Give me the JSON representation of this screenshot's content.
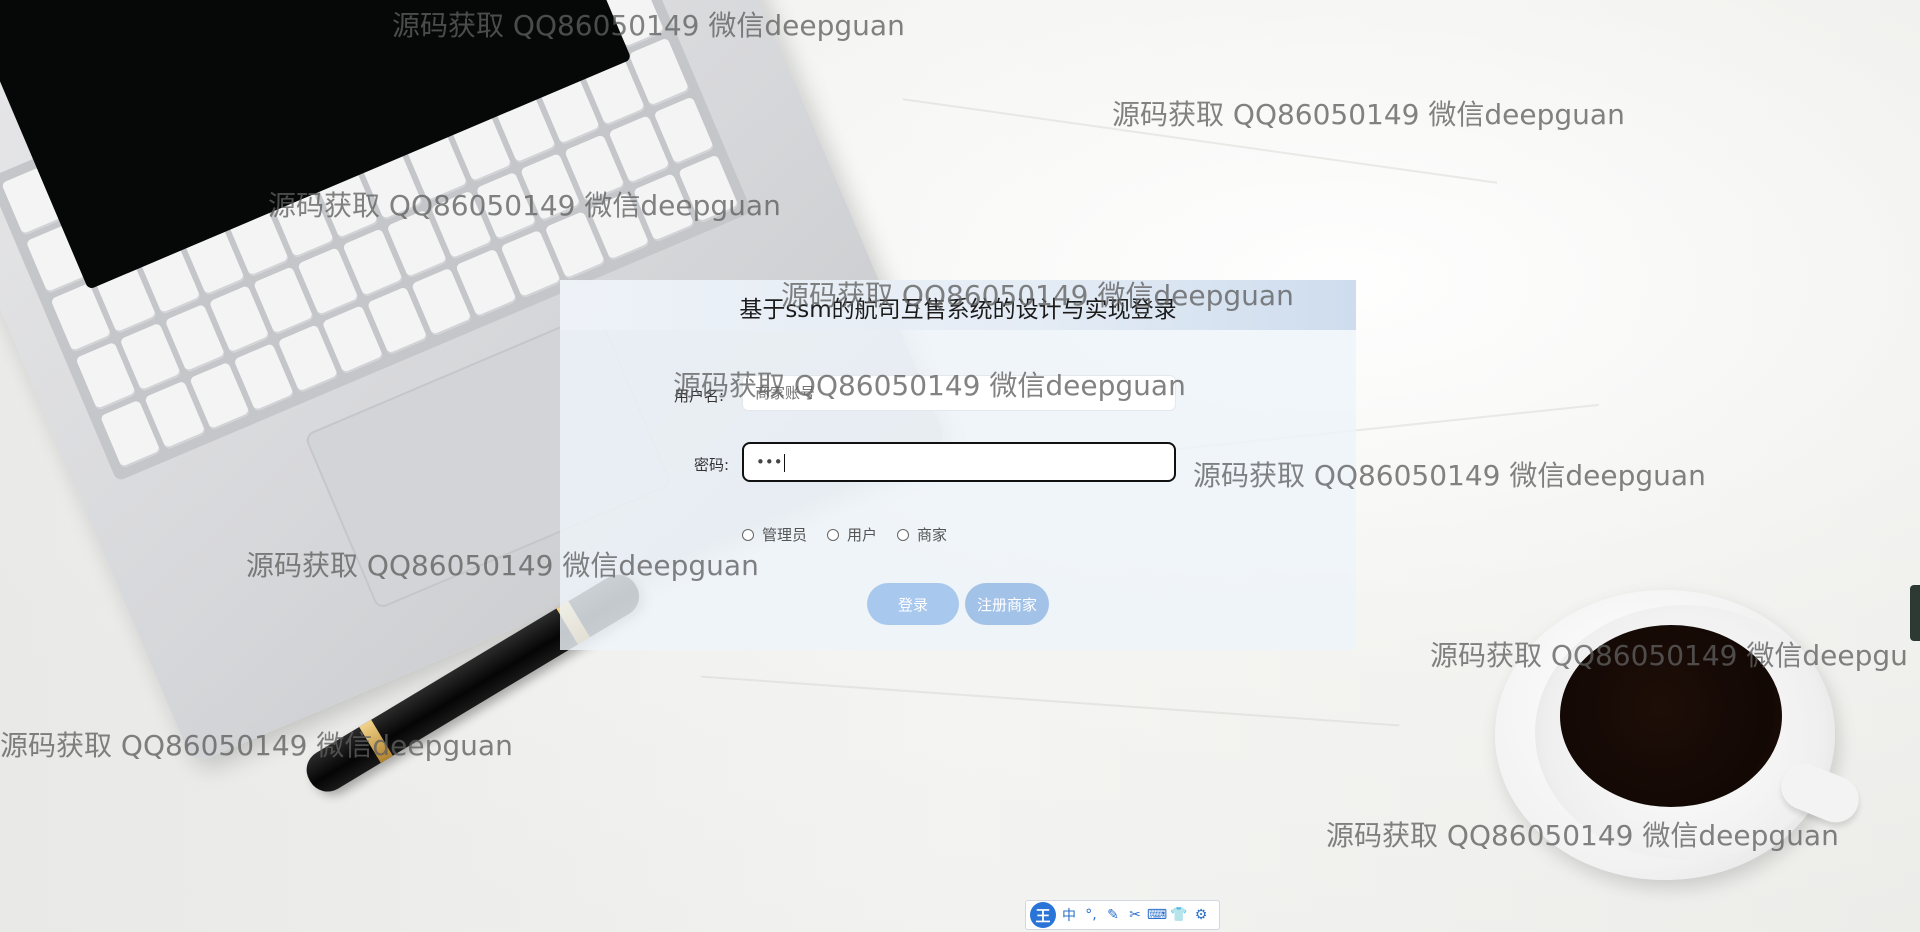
{
  "login": {
    "title": "基于ssm的航司互售系统的设计与实现登录",
    "username_label": "用户名:",
    "username_placeholder": "商家账号",
    "password_label": "密码:",
    "password_value": "•••",
    "roles": [
      "管理员",
      "用户",
      "商家"
    ],
    "login_button": "登录",
    "register_button": "注册商家"
  },
  "watermark": {
    "text": "源码获取 QQ86050149 微信deepguan",
    "text_cut": "源码获取 QQ86050149 微信deepgu"
  },
  "ime": {
    "logo": "王",
    "items": [
      "中",
      "°,",
      "✎",
      "✂",
      "⌨",
      "👕",
      "⚙"
    ]
  }
}
